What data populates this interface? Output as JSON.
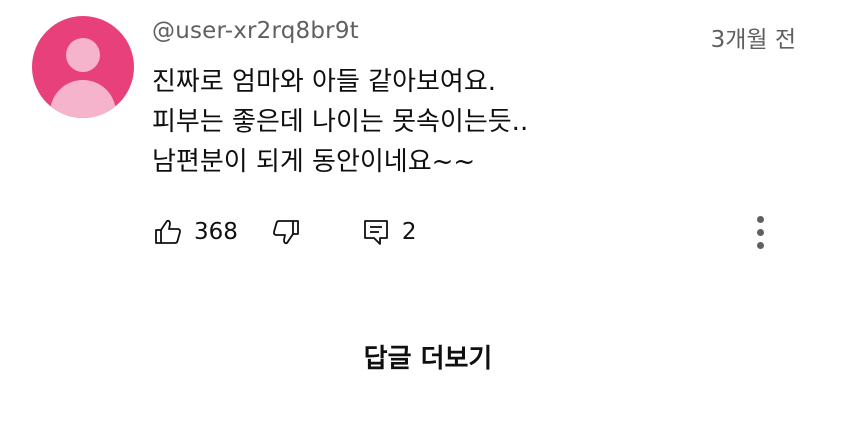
{
  "comment": {
    "username": "@user-xr2rq8br9t",
    "timestamp": "3개월 전",
    "text_lines": [
      "진짜로 엄마와 아들 같아보여요.",
      "피부는 좋은데 나이는 못속이는듯..",
      "남편분이 되게 동안이네요~~"
    ],
    "like_count": "368",
    "reply_count": "2"
  },
  "more_replies_label": "답글 더보기",
  "icons": {
    "avatar": "default-avatar-icon",
    "like": "thumb-up-icon",
    "dislike": "thumb-down-icon",
    "reply": "reply-icon",
    "more": "more-vertical-icon"
  },
  "colors": {
    "avatar_bg": "#e8407a",
    "avatar_fg": "#f6b3cc",
    "secondary_text": "#606060",
    "primary_text": "#0f0f0f"
  }
}
